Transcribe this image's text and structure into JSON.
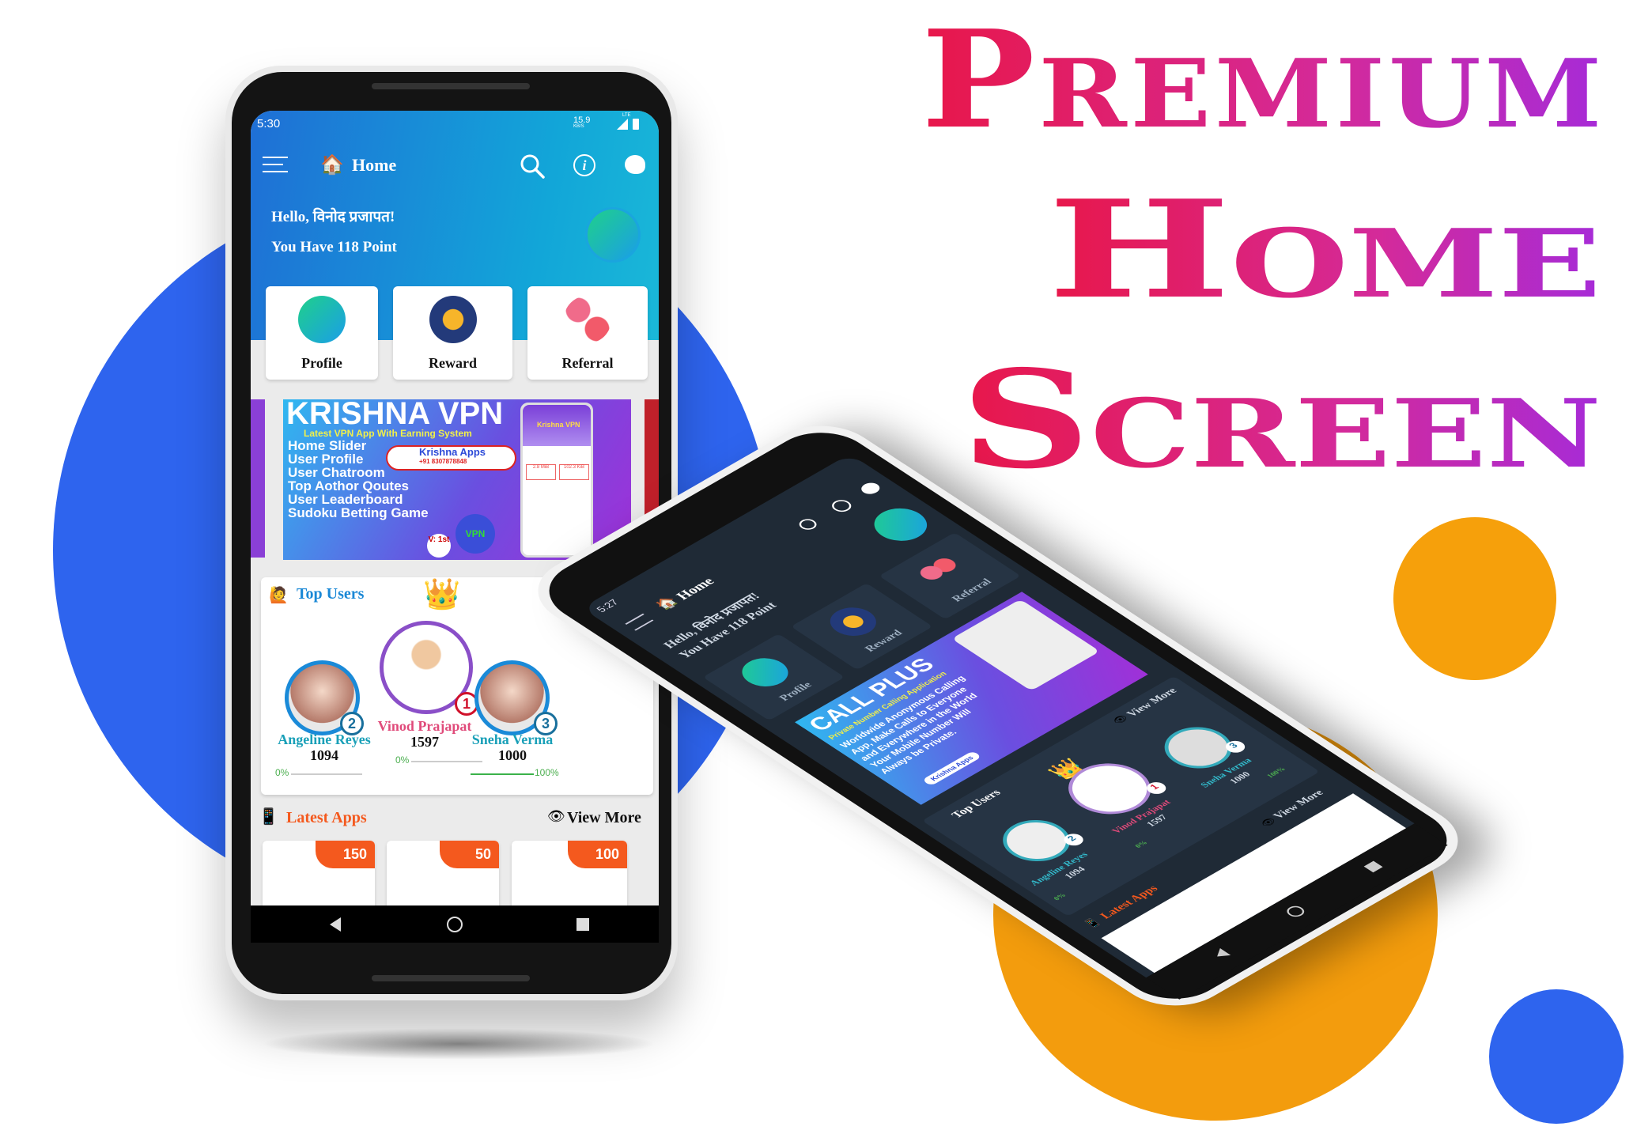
{
  "headline": {
    "lines": [
      "Premium",
      "Home",
      "Screen"
    ],
    "gradient": [
      "#e8174a",
      "#d42a9a",
      "#a62bd8"
    ]
  },
  "colors": {
    "blue_circle": "#2e64ee",
    "orange_circle": "#f6a00b",
    "accent_orange": "#f4591e"
  },
  "phone_light": {
    "status": {
      "time": "5:30",
      "speed": "15.9",
      "speed_unit": "KB/S",
      "network": "LTE"
    },
    "appbar": {
      "title": "Home",
      "icons": [
        "menu-icon",
        "home-icon",
        "search-icon",
        "info-icon",
        "palette-icon"
      ]
    },
    "greeting": "Hello, विनोद प्रजापत!",
    "points": "You Have 118 Point",
    "tiles": [
      {
        "label": "Profile"
      },
      {
        "label": "Reward"
      },
      {
        "label": "Referral"
      }
    ],
    "banner": {
      "title": "KRISHNA VPN",
      "subtitle": "Latest VPN App With Earning System",
      "features": [
        "Home Slider",
        "User Profile",
        "User Chatroom",
        "Top Aothor Qoutes",
        "User Leaderboard",
        "Sudoku Betting Game"
      ],
      "brand": "Krishna Apps",
      "phone": "+91 8307878848",
      "version": "V: 1st",
      "mock_title": "Krishna VPN",
      "mock_download": "2.8 MiB",
      "mock_upload": "102.3 KiB",
      "badge": "VPN"
    },
    "top_users": {
      "title": "Top Users",
      "users": [
        {
          "name": "Angeline Reyes",
          "points": "1094",
          "rank": "2",
          "progress_label": "0%",
          "progress": 0
        },
        {
          "name": "Vinod Prajapat",
          "points": "1597",
          "rank": "1",
          "progress_label": "0%",
          "progress": 0
        },
        {
          "name": "Sneha Verma",
          "points": "1000",
          "rank": "3",
          "progress_label": "100%",
          "progress": 100
        }
      ]
    },
    "latest_apps": {
      "title": "Latest Apps",
      "view_more": "View More",
      "coins": [
        "150",
        "50",
        "100"
      ]
    }
  },
  "phone_dark": {
    "status": {
      "time": "5:27"
    },
    "appbar": {
      "title": "Home"
    },
    "greeting": "Hello, विनोद प्रजापत!",
    "points": "You Have 118 Point",
    "tiles": [
      {
        "label": "Profile"
      },
      {
        "label": "Reward"
      },
      {
        "label": "Referral"
      }
    ],
    "banner": {
      "title": "CALL PLUS",
      "subtitle": "Private Number Calling Application",
      "lines": [
        "Worldwide Anonymous Calling",
        "App, Make Calls to Everyone",
        "and Everywhere in the World",
        "Your Mobile Number Will",
        "Always be Private."
      ],
      "brand": "Krishna Apps"
    },
    "top_users": {
      "title": "Top Users",
      "view_more": "View More",
      "users": [
        {
          "name": "Angeline Reyes",
          "points": "1094",
          "rank": "2",
          "progress_label": "0%"
        },
        {
          "name": "Vinod Prajapat",
          "points": "1597",
          "rank": "1",
          "progress_label": "0%"
        },
        {
          "name": "Sneha Verma",
          "points": "1000",
          "rank": "3",
          "progress_label": "100%"
        }
      ]
    },
    "latest_apps": {
      "title": "Latest Apps",
      "view_more": "View More"
    }
  }
}
